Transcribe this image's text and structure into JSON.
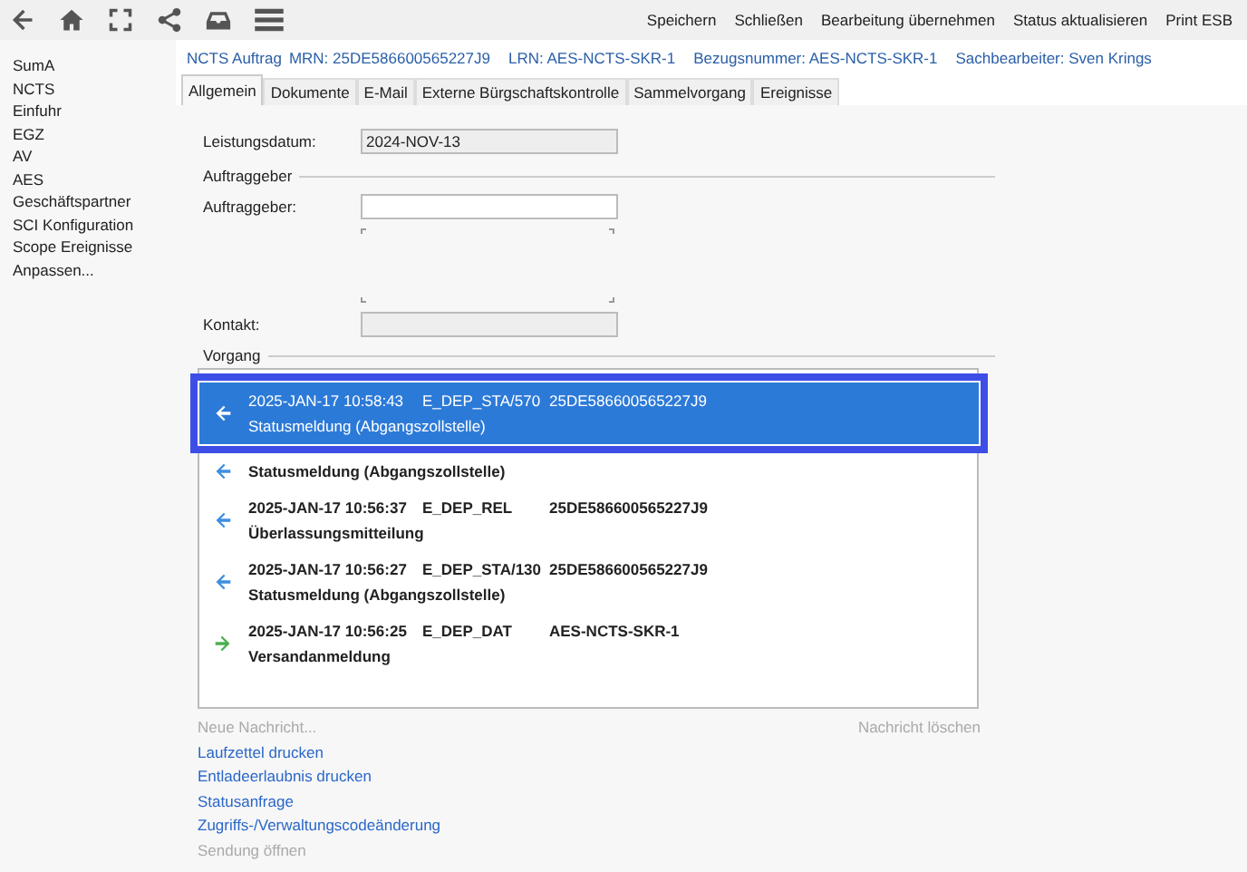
{
  "toolbar": {
    "actions": [
      "Speichern",
      "Schließen",
      "Bearbeitung übernehmen",
      "Status aktualisieren",
      "Print ESB"
    ]
  },
  "sidebar": {
    "items": [
      "SumA",
      "NCTS",
      "Einfuhr",
      "EGZ",
      "AV",
      "AES",
      "Geschäftspartner",
      "SCI Konfiguration",
      "Scope Ereignisse",
      "Anpassen..."
    ]
  },
  "header": [
    "NCTS Auftrag",
    "MRN: 25DE586600565227J9",
    "LRN: AES-NCTS-SKR-1",
    "Bezugsnummer: AES-NCTS-SKR-1",
    "Sachbearbeiter: Sven Krings"
  ],
  "tabs": [
    {
      "label": "Allgemein",
      "selected": true
    },
    {
      "label": "Dokumente",
      "selected": false
    },
    {
      "label": "E-Mail",
      "selected": false
    },
    {
      "label": "Externe Bürgschaftskontrolle",
      "selected": false
    },
    {
      "label": "Sammelvorgang",
      "selected": false
    },
    {
      "label": "Ereignisse",
      "selected": false
    }
  ],
  "form": {
    "service_date_label": "Leistungsdatum:",
    "service_date": "2024-NOV-13",
    "client_group": "Auftraggeber",
    "client_label": "Auftraggeber:",
    "contact_label": "Kontakt:"
  },
  "process": {
    "title": "Vorgang",
    "messages": [
      {
        "kind": "incoming",
        "selected": true,
        "timestamp": "2025-JAN-17 10:58:43",
        "code": "E_DEP_STA/570",
        "reference": "25DE586600565227J9",
        "description": "Statusmeldung (Abgangszollstelle)"
      },
      {
        "kind": "incoming",
        "selected": false,
        "description": "Statusmeldung (Abgangszollstelle)"
      },
      {
        "kind": "incoming",
        "selected": false,
        "timestamp": "2025-JAN-17 10:56:37",
        "code": "E_DEP_REL",
        "reference": "25DE586600565227J9",
        "description": "Überlassungsmitteilung"
      },
      {
        "kind": "incoming",
        "selected": false,
        "timestamp": "2025-JAN-17 10:56:27",
        "code": "E_DEP_STA/130",
        "reference": "25DE586600565227J9",
        "description": "Statusmeldung (Abgangszollstelle)"
      },
      {
        "kind": "outgoing",
        "selected": false,
        "timestamp": "2025-JAN-17 10:56:25",
        "code": "E_DEP_DAT",
        "reference": "AES-NCTS-SKR-1",
        "description": "Versandanmeldung"
      }
    ],
    "new_message": {
      "label": "Neue Nachricht...",
      "disabled": true
    },
    "delete_message": {
      "label": "Nachricht löschen",
      "disabled": true
    }
  },
  "links": [
    {
      "label": "Laufzettel drucken",
      "disabled": false
    },
    {
      "label": "Entladeerlaubnis drucken",
      "disabled": false
    },
    {
      "label": "Statusanfrage",
      "disabled": false
    },
    {
      "label": "Zugriffs-/Verwaltungscodeänderung",
      "disabled": false
    },
    {
      "label": "Sendung öffnen",
      "disabled": true
    }
  ]
}
